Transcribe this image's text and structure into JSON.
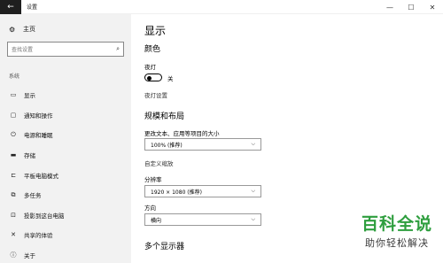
{
  "window": {
    "title": "设置",
    "back_glyph": "←",
    "minimize_glyph": "—",
    "maximize_glyph": "☐",
    "close_glyph": "✕"
  },
  "sidebar": {
    "home_label": "主页",
    "search_placeholder": "查找设置",
    "section_label": "系统",
    "items": [
      {
        "label": "显示",
        "icon": "monitor-icon",
        "glyph": "▭"
      },
      {
        "label": "通知和操作",
        "icon": "message-icon",
        "glyph": "▢"
      },
      {
        "label": "电源和睡眠",
        "icon": "power-icon",
        "glyph": "⏻"
      },
      {
        "label": "存储",
        "icon": "storage-icon",
        "glyph": "▬"
      },
      {
        "label": "平板电脑模式",
        "icon": "tablet-mode-icon",
        "glyph": "⊏"
      },
      {
        "label": "多任务",
        "icon": "multitask-icon",
        "glyph": "⧉"
      },
      {
        "label": "投影到这台电脑",
        "icon": "projector-icon",
        "glyph": "⊡"
      },
      {
        "label": "共享的体验",
        "icon": "shared-experience-icon",
        "glyph": "✕"
      },
      {
        "label": "关于",
        "icon": "info-icon",
        "glyph": "ⓘ"
      }
    ]
  },
  "main": {
    "title": "显示",
    "color_heading": "颜色",
    "night_light_label": "夜灯",
    "night_light_state": "关",
    "night_light_settings_link": "夜灯设置",
    "scale_heading": "规模和布局",
    "scale_label": "更改文本、应用等项目的大小",
    "scale_value": "100% (推荐)",
    "custom_scale_link": "自定义缩放",
    "resolution_label": "分辨率",
    "resolution_value": "1920 × 1080 (推荐)",
    "orientation_label": "方向",
    "orientation_value": "横向",
    "multi_display_heading": "多个显示器"
  },
  "watermark": {
    "main": "百科全说",
    "sub": "助你轻松解决"
  },
  "colors": {
    "sidebar_bg": "#f2f2f2",
    "watermark_green": "#2e9e3e"
  }
}
